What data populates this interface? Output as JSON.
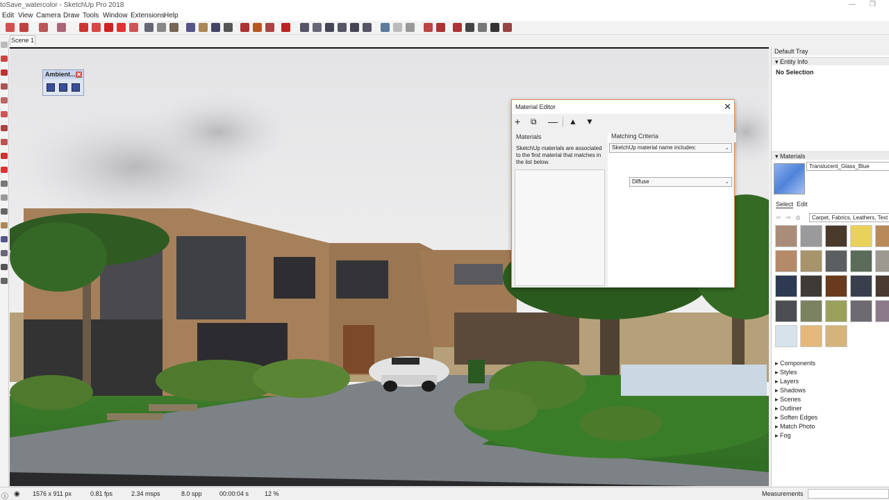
{
  "window": {
    "title": "toSave_watercolor - SketchUp Pro 2018"
  },
  "menu": [
    "Edit",
    "View",
    "Camera",
    "Draw",
    "Tools",
    "Window",
    "Extensions",
    "Help"
  ],
  "scene_tab": "Scene 1",
  "ambient_toolbar": {
    "title": "Ambient..."
  },
  "material_editor": {
    "title": "Material Editor",
    "materials_label": "Materials",
    "description": "SketchUp materials are associated to the first material that matches in the list below.",
    "matching_label": "Matching Criteria",
    "criteria_value": "SketchUp material name includes:",
    "type_value": "Diffuse"
  },
  "tray": {
    "title": "Default Tray",
    "entity_info": "Entity Info",
    "no_selection": "No Selection",
    "materials_header": "Materials",
    "material_name": "Translucent_Glass_Blue",
    "tab_select": "Select",
    "tab_edit": "Edit",
    "collection": "Carpet, Fabrics, Leathers, Text",
    "swatch_colors": [
      "#a98d7a",
      "#9a9a9c",
      "#4a3a2c",
      "#e8d25a",
      "#b88a5a",
      "#b48a68",
      "#a8946a",
      "#5c5f62",
      "#5a6b5a",
      "#9c9a90",
      "#2e3a52",
      "#3e3a36",
      "#6a3a1e",
      "#3a3f4e",
      "#4a3a30",
      "#4c4e52",
      "#7a8260",
      "#9aa05a",
      "#6e6a72",
      "#8a7a8a",
      "#d8e2ea",
      "#e4b87a",
      "#d4b47a"
    ],
    "panels": [
      "Components",
      "Styles",
      "Layers",
      "Shadows",
      "Scenes",
      "Outliner",
      "Soften Edges",
      "Match Photo",
      "Fog"
    ]
  },
  "status": {
    "resolution": "1576 x 911 px",
    "fps": "0.81 fps",
    "msps": "2.34 msps",
    "spp": "8.0 spp",
    "time": "00:00:04 s",
    "percent": "12 %",
    "measurements": "Measurements"
  }
}
